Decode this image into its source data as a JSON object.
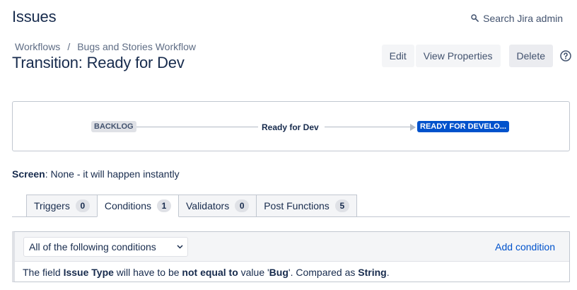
{
  "header": {
    "title": "Issues",
    "search_label": "Search Jira admin"
  },
  "breadcrumb": {
    "items": [
      "Workflows",
      "Bugs and Stories Workflow"
    ],
    "separator": "/"
  },
  "transition": {
    "title": "Transition: Ready for Dev"
  },
  "actions": {
    "edit_label": "Edit",
    "view_properties_label": "View Properties",
    "delete_label": "Delete"
  },
  "diagram": {
    "from_status": "BACKLOG",
    "transition_name": "Ready for Dev",
    "to_status": "READY FOR DEVELO...",
    "to_status_color": "#0052cc",
    "from_status_color": "#dfe1e6"
  },
  "screen": {
    "label": "Screen",
    "value": ": None - it will happen instantly"
  },
  "tabs": [
    {
      "label": "Triggers",
      "count": "0",
      "active": false
    },
    {
      "label": "Conditions",
      "count": "1",
      "active": true
    },
    {
      "label": "Validators",
      "count": "0",
      "active": false
    },
    {
      "label": "Post Functions",
      "count": "5",
      "active": false
    }
  ],
  "conditions": {
    "selector_value": "All of the following conditions",
    "add_label": "Add condition",
    "rule": {
      "p1": "The field ",
      "field": "Issue Type",
      "p2": " will have to be ",
      "operator": "not equal to",
      "p3": " value '",
      "value": "Bug",
      "p4": "'. Compared as ",
      "type": "String",
      "p5": "."
    }
  },
  "icons": {
    "search": "search-icon",
    "help": "help-icon",
    "chevron": "chevron-down-icon"
  },
  "colors": {
    "link": "#0052cc",
    "text": "#172b4d"
  }
}
